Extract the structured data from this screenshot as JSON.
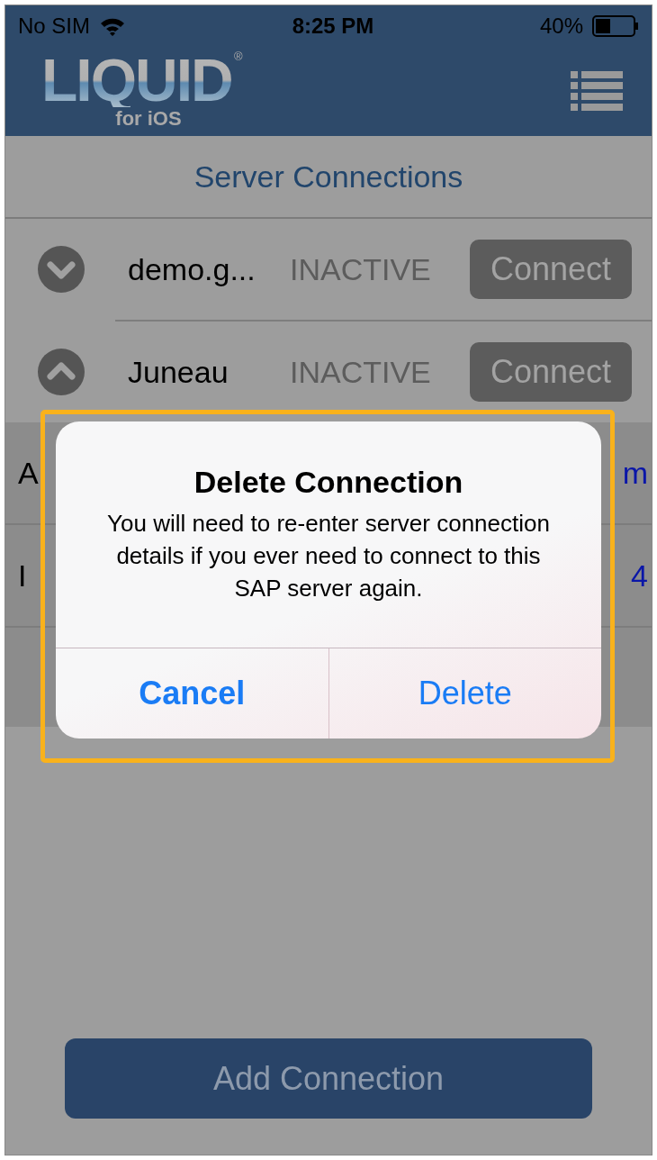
{
  "status_bar": {
    "carrier": "No SIM",
    "time": "8:25 PM",
    "battery": "40%"
  },
  "header": {
    "logo": "LIQUID",
    "logo_mark": "®",
    "logo_sub": "for iOS"
  },
  "title": "Server Connections",
  "connections": [
    {
      "name": "demo.g...",
      "status": "INACTIVE",
      "button": "Connect",
      "expanded": false
    },
    {
      "name": "Juneau",
      "status": "INACTIVE",
      "button": "Connect",
      "expanded": true
    }
  ],
  "details": [
    {
      "label": "A",
      "value": "m"
    },
    {
      "label": "I",
      "value": "4"
    }
  ],
  "dialog": {
    "title": "Delete Connection",
    "message": "You will need to re-enter server connection details if you ever need to connect to this SAP server again.",
    "highlighted": true,
    "buttons": [
      {
        "label": "Cancel",
        "kind": "cancel"
      },
      {
        "label": "Delete",
        "kind": "destructive"
      }
    ]
  },
  "add_button": "Add Connection"
}
